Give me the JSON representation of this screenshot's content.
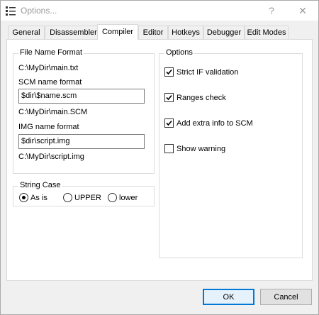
{
  "window": {
    "title": "Options...",
    "help_glyph": "?",
    "close_glyph": "✕"
  },
  "tabs": [
    {
      "label": "General"
    },
    {
      "label": "Disassembler"
    },
    {
      "label": "Compiler"
    },
    {
      "label": "Editor"
    },
    {
      "label": "Hotkeys"
    },
    {
      "label": "Debugger"
    },
    {
      "label": "Edit Modes"
    }
  ],
  "active_tab": "Compiler",
  "file_name_format": {
    "label": "File Name Format",
    "main_path": "C:\\MyDir\\main.txt",
    "scm_label": "SCM name format",
    "scm_value": "$dir\\$name.scm",
    "scm_preview": "C:\\MyDir\\main.SCM",
    "img_label": "IMG name format",
    "img_value": "$dir\\script.img",
    "img_preview": "C:\\MyDir\\script.img"
  },
  "string_case": {
    "label": "String Case",
    "options": [
      {
        "label": "As is",
        "selected": true
      },
      {
        "label": "UPPER",
        "selected": false
      },
      {
        "label": "lower",
        "selected": false
      }
    ]
  },
  "options": {
    "label": "Options",
    "items": [
      {
        "label": "Strict IF validation",
        "checked": true
      },
      {
        "label": "Ranges check",
        "checked": true
      },
      {
        "label": "Add extra info to SCM",
        "checked": true
      },
      {
        "label": "Show warning",
        "checked": false
      }
    ]
  },
  "buttons": {
    "ok": "OK",
    "cancel": "Cancel"
  }
}
